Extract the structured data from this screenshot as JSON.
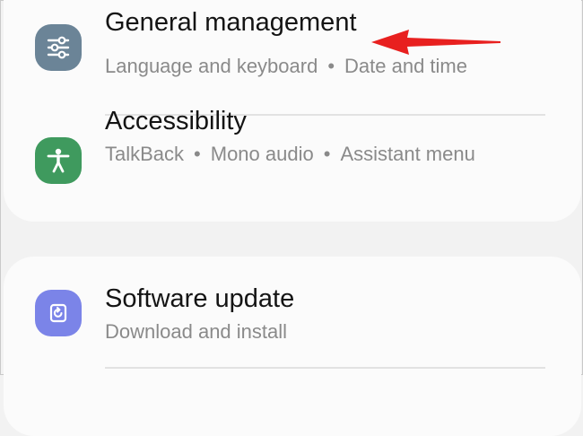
{
  "settings": {
    "group1": [
      {
        "title": "General management",
        "subtitle_parts": [
          "Language and keyboard",
          "Date and time"
        ],
        "icon": "sliders-icon",
        "icon_color": "#6b8497"
      },
      {
        "title": "Accessibility",
        "subtitle_parts": [
          "TalkBack",
          "Mono audio",
          "Assistant menu"
        ],
        "icon": "accessibility-person-icon",
        "icon_color": "#3f9a5e"
      }
    ],
    "group2": [
      {
        "title": "Software update",
        "subtitle_parts": [
          "Download and install"
        ],
        "icon": "update-refresh-icon",
        "icon_color": "#7b84e8"
      }
    ],
    "separator": "•"
  },
  "annotation": {
    "arrow_color": "#e8201f",
    "icon": "red-arrow-icon"
  }
}
